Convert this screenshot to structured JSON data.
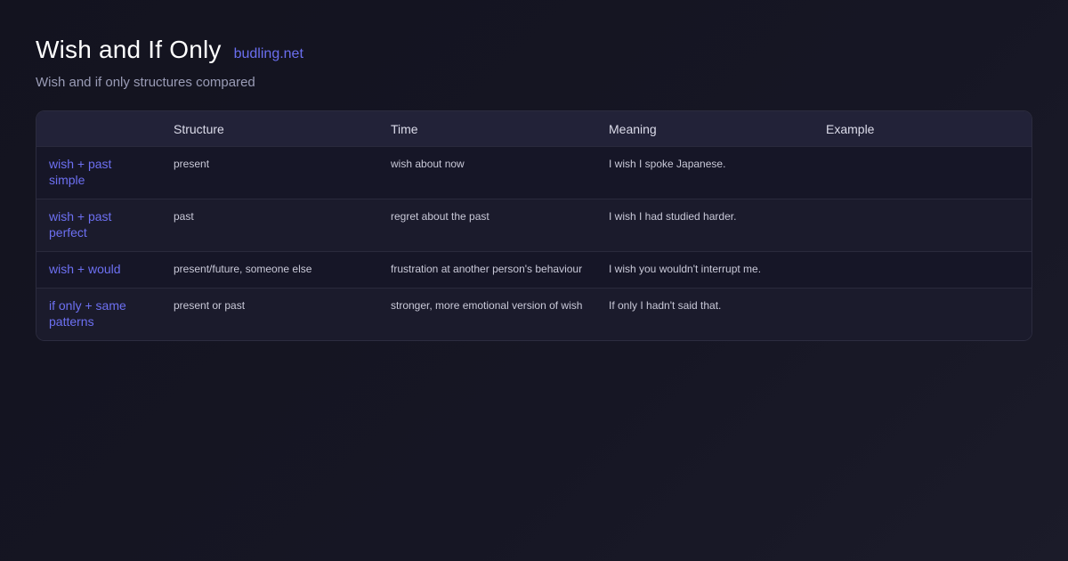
{
  "header": {
    "title": "Wish and If Only",
    "brand": "budling.net",
    "subtitle": "Wish and if only structures compared"
  },
  "table": {
    "columns": [
      "",
      "Structure",
      "Time",
      "Meaning",
      "Example"
    ],
    "rows": [
      {
        "label": "wish + past simple",
        "structure": "present",
        "time": "wish about now",
        "meaning": "I wish I spoke Japanese.",
        "example": ""
      },
      {
        "label": "wish + past perfect",
        "structure": "past",
        "time": "regret about the past",
        "meaning": "I wish I had studied harder.",
        "example": ""
      },
      {
        "label": "wish + would",
        "structure": "present/future, someone else",
        "time": "frustration at another person's behaviour",
        "meaning": "I wish you wouldn't interrupt me.",
        "example": ""
      },
      {
        "label": "if only + same patterns",
        "structure": "present or past",
        "time": "stronger, more emotional version of wish",
        "meaning": "If only I hadn't said that.",
        "example": ""
      }
    ]
  },
  "colors": {
    "accent": "#6b6ff0",
    "background": "#13131f",
    "header_row": "#222238"
  }
}
